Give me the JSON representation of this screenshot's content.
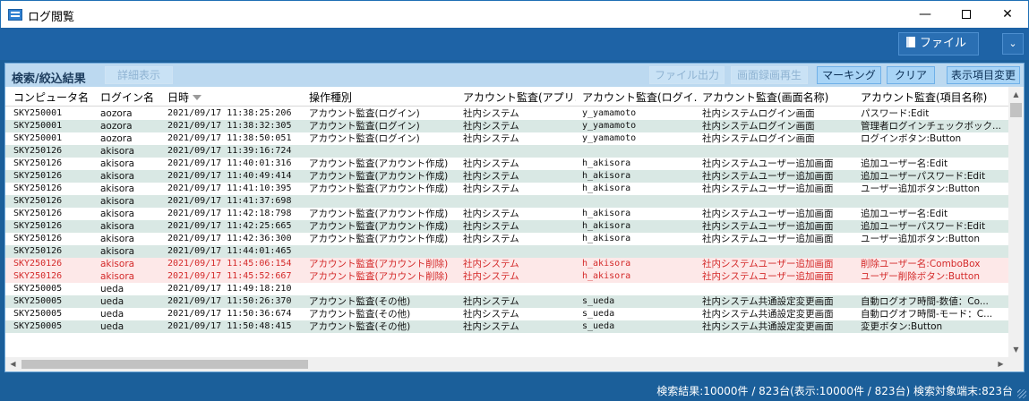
{
  "window": {
    "title": "ログ閲覧",
    "minimize_glyph": "—",
    "close_glyph": "✕"
  },
  "toolbar": {
    "file_label": "ファイル",
    "collapse_glyph": "⌄"
  },
  "panel": {
    "title": "検索/絞込結果",
    "buttons": {
      "detail": "詳細表示",
      "file_output": "ファイル出力",
      "screen_replay": "画面録画再生",
      "marking": "マーキング",
      "clear": "クリア",
      "display_columns": "表示項目変更"
    }
  },
  "grid": {
    "columns": [
      "コンピュータ名",
      "ログイン名",
      "日時",
      "操作種別",
      "アカウント監査(アプリ...",
      "アカウント監査(ログイ...",
      "アカウント監査(画面名称)",
      "アカウント監査(項目名称)"
    ],
    "sorted_column": "日時",
    "rows": [
      {
        "pc": "SKY250001",
        "user": "aozora",
        "datetime": "2021/09/17 11:38:25:206",
        "op": "アカウント監査(ログイン)",
        "app": "社内システム",
        "login": "y_yamamoto",
        "screen": "社内システムログイン画面",
        "item": "パスワード:Edit",
        "alert": false
      },
      {
        "pc": "SKY250001",
        "user": "aozora",
        "datetime": "2021/09/17 11:38:32:305",
        "op": "アカウント監査(ログイン)",
        "app": "社内システム",
        "login": "y_yamamoto",
        "screen": "社内システムログイン画面",
        "item": "管理者ログインチェックボック...",
        "alert": false
      },
      {
        "pc": "SKY250001",
        "user": "aozora",
        "datetime": "2021/09/17 11:38:50:051",
        "op": "アカウント監査(ログイン)",
        "app": "社内システム",
        "login": "y_yamamoto",
        "screen": "社内システムログイン画面",
        "item": "ログインボタン:Button",
        "alert": false
      },
      {
        "pc": "SKY250126",
        "user": "akisora",
        "datetime": "2021/09/17 11:39:16:724",
        "op": "",
        "app": "",
        "login": "",
        "screen": "",
        "item": "",
        "alert": false
      },
      {
        "pc": "SKY250126",
        "user": "akisora",
        "datetime": "2021/09/17 11:40:01:316",
        "op": "アカウント監査(アカウント作成)",
        "app": "社内システム",
        "login": "h_akisora",
        "screen": "社内システムユーザー追加画面",
        "item": "追加ユーザー名:Edit",
        "alert": false
      },
      {
        "pc": "SKY250126",
        "user": "akisora",
        "datetime": "2021/09/17 11:40:49:414",
        "op": "アカウント監査(アカウント作成)",
        "app": "社内システム",
        "login": "h_akisora",
        "screen": "社内システムユーザー追加画面",
        "item": "追加ユーザーパスワード:Edit",
        "alert": false
      },
      {
        "pc": "SKY250126",
        "user": "akisora",
        "datetime": "2021/09/17 11:41:10:395",
        "op": "アカウント監査(アカウント作成)",
        "app": "社内システム",
        "login": "h_akisora",
        "screen": "社内システムユーザー追加画面",
        "item": "ユーザー追加ボタン:Button",
        "alert": false
      },
      {
        "pc": "SKY250126",
        "user": "akisora",
        "datetime": "2021/09/17 11:41:37:698",
        "op": "",
        "app": "",
        "login": "",
        "screen": "",
        "item": "",
        "alert": false
      },
      {
        "pc": "SKY250126",
        "user": "akisora",
        "datetime": "2021/09/17 11:42:18:798",
        "op": "アカウント監査(アカウント作成)",
        "app": "社内システム",
        "login": "h_akisora",
        "screen": "社内システムユーザー追加画面",
        "item": "追加ユーザー名:Edit",
        "alert": false
      },
      {
        "pc": "SKY250126",
        "user": "akisora",
        "datetime": "2021/09/17 11:42:25:665",
        "op": "アカウント監査(アカウント作成)",
        "app": "社内システム",
        "login": "h_akisora",
        "screen": "社内システムユーザー追加画面",
        "item": "追加ユーザーパスワード:Edit",
        "alert": false
      },
      {
        "pc": "SKY250126",
        "user": "akisora",
        "datetime": "2021/09/17 11:42:36:300",
        "op": "アカウント監査(アカウント作成)",
        "app": "社内システム",
        "login": "h_akisora",
        "screen": "社内システムユーザー追加画面",
        "item": "ユーザー追加ボタン:Button",
        "alert": false
      },
      {
        "pc": "SKY250126",
        "user": "akisora",
        "datetime": "2021/09/17 11:44:01:465",
        "op": "",
        "app": "",
        "login": "",
        "screen": "",
        "item": "",
        "alert": false
      },
      {
        "pc": "SKY250126",
        "user": "akisora",
        "datetime": "2021/09/17 11:45:06:154",
        "op": "アカウント監査(アカウント削除)",
        "app": "社内システム",
        "login": "h_akisora",
        "screen": "社内システムユーザー追加画面",
        "item": "削除ユーザー名:ComboBox",
        "alert": true
      },
      {
        "pc": "SKY250126",
        "user": "akisora",
        "datetime": "2021/09/17 11:45:52:667",
        "op": "アカウント監査(アカウント削除)",
        "app": "社内システム",
        "login": "h_akisora",
        "screen": "社内システムユーザー追加画面",
        "item": "ユーザー削除ボタン:Button",
        "alert": true
      },
      {
        "pc": "SKY250005",
        "user": "ueda",
        "datetime": "2021/09/17 11:49:18:210",
        "op": "",
        "app": "",
        "login": "",
        "screen": "",
        "item": "",
        "alert": false
      },
      {
        "pc": "SKY250005",
        "user": "ueda",
        "datetime": "2021/09/17 11:50:26:370",
        "op": "アカウント監査(その他)",
        "app": "社内システム",
        "login": "s_ueda",
        "screen": "社内システム共通設定変更画面",
        "item": "自動ログオフ時間-数値：Co...",
        "alert": false
      },
      {
        "pc": "SKY250005",
        "user": "ueda",
        "datetime": "2021/09/17 11:50:36:674",
        "op": "アカウント監査(その他)",
        "app": "社内システム",
        "login": "s_ueda",
        "screen": "社内システム共通設定変更画面",
        "item": "自動ログオフ時間-モード：C...",
        "alert": false
      },
      {
        "pc": "SKY250005",
        "user": "ueda",
        "datetime": "2021/09/17 11:50:48:415",
        "op": "アカウント監査(その他)",
        "app": "社内システム",
        "login": "s_ueda",
        "screen": "社内システム共通設定変更画面",
        "item": "変更ボタン:Button",
        "alert": false
      }
    ]
  },
  "status": {
    "text": "検索結果:10000件 / 823台(表示:10000件 / 823台) 検索対象端末:823台"
  },
  "colors": {
    "window_blue": "#1b5f9a",
    "panel_header": "#bcd9f0",
    "row_alt": "#d9e8e4",
    "alert_text": "#d42a2a"
  }
}
